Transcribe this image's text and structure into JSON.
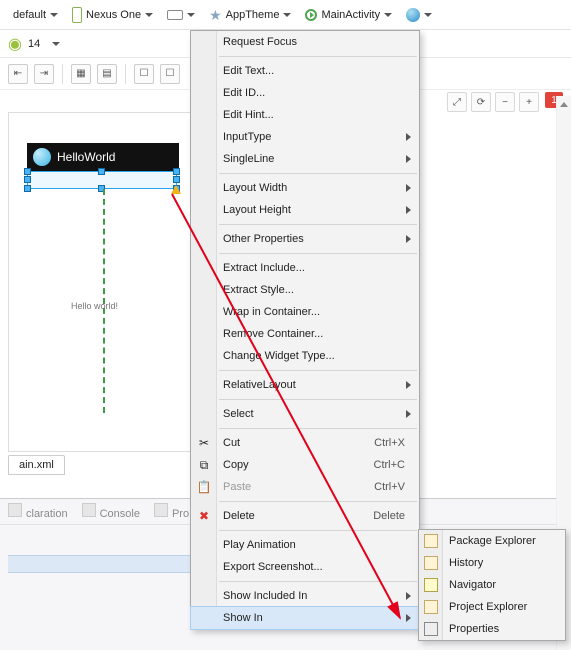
{
  "config": {
    "preset": "default",
    "device": "Nexus One",
    "theme": "AppTheme",
    "activity": "MainActivity"
  },
  "api": {
    "level": "14"
  },
  "canvas": {
    "app_title": "HelloWorld",
    "body_text": "Hello world!"
  },
  "zoom": {
    "badge": "1"
  },
  "editor": {
    "tab": "ain.xml"
  },
  "lower_tabs": {
    "a": "claration",
    "b": "Console",
    "c": "Pro"
  },
  "context_menu": {
    "request_focus": "Request Focus",
    "edit_text": "Edit Text...",
    "edit_id": "Edit ID...",
    "edit_hint": "Edit Hint...",
    "input_type": "InputType",
    "single_line": "SingleLine",
    "layout_width": "Layout Width",
    "layout_height": "Layout Height",
    "other_props": "Other Properties",
    "extract_include": "Extract Include...",
    "extract_style": "Extract Style...",
    "wrap_in": "Wrap in Container...",
    "remove_container": "Remove Container...",
    "change_widget": "Change Widget Type...",
    "relative_layout": "RelativeLayout",
    "select": "Select",
    "cut": "Cut",
    "copy": "Copy",
    "paste": "Paste",
    "delete": "Delete",
    "play_anim": "Play Animation",
    "export_ss": "Export Screenshot...",
    "show_included": "Show Included In",
    "show_in": "Show In",
    "sc_cut": "Ctrl+X",
    "sc_copy": "Ctrl+C",
    "sc_paste": "Ctrl+V",
    "sc_delete": "Delete"
  },
  "submenu": {
    "pkg_explorer": "Package Explorer",
    "history": "History",
    "navigator": "Navigator",
    "proj_explorer": "Project Explorer",
    "properties": "Properties"
  }
}
